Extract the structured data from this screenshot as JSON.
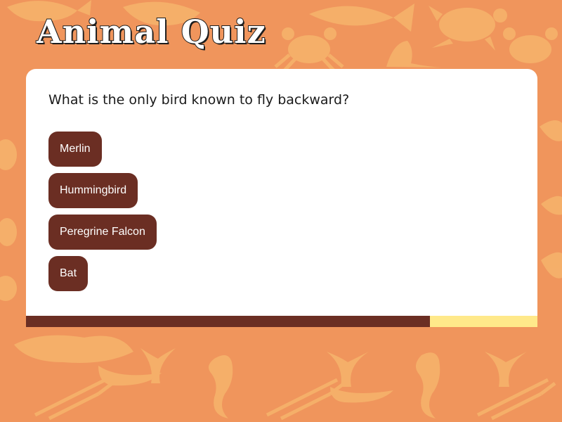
{
  "app": {
    "title": "Animal Quiz"
  },
  "quiz": {
    "question": "What is the only bird known to fly backward?",
    "options": [
      {
        "label": "Merlin"
      },
      {
        "label": "Hummingbird"
      },
      {
        "label": "Peregrine Falcon"
      },
      {
        "label": "Bat"
      }
    ],
    "progress_fraction": 0.79
  },
  "colors": {
    "background": "#f0955c",
    "pattern": "#f6b46c",
    "button": "#6b2e23",
    "progress_fill": "#6b2e23",
    "progress_track": "#ffe98a",
    "card": "#ffffff"
  },
  "background_icons": [
    "whale-icon",
    "crab-icon",
    "turtle-icon",
    "seal-icon",
    "fish-icon",
    "seahorse-icon",
    "lobster-icon",
    "whale-tail-icon"
  ]
}
